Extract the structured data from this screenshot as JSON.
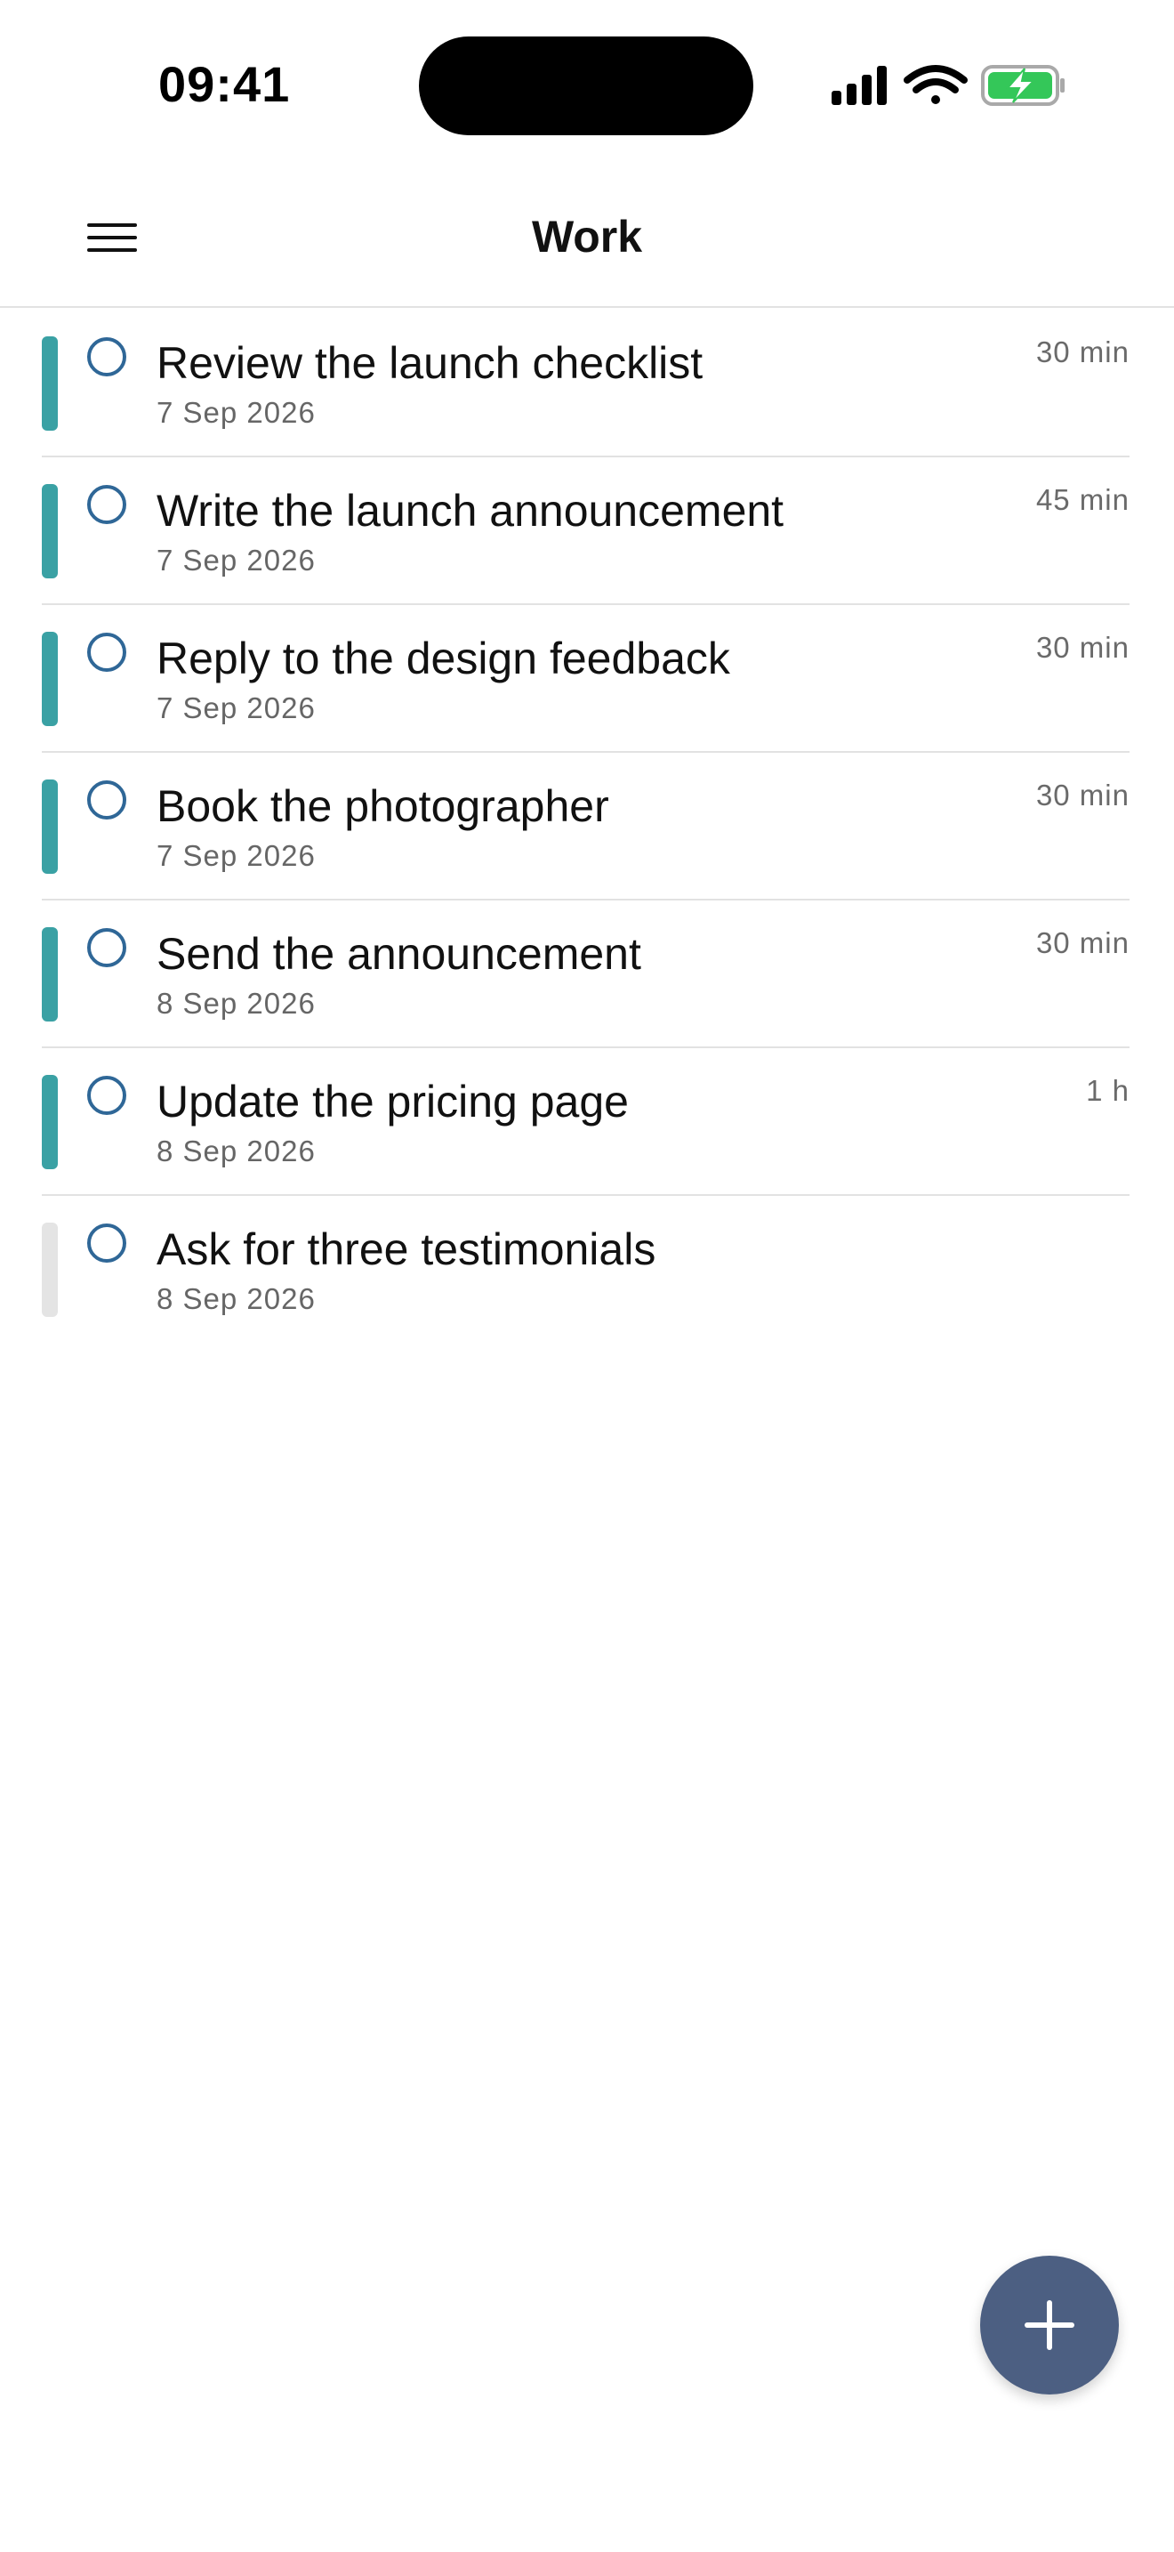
{
  "status_bar": {
    "time": "09:41"
  },
  "header": {
    "title": "Work",
    "menu_icon": "hamburger-menu-icon"
  },
  "colors": {
    "accent_teal": "#3aa1a4",
    "inactive_bar": "#e4e4e4",
    "checkbox": "#2f6797",
    "fab": "#4c5f82",
    "battery_green": "#34c759"
  },
  "tasks": [
    {
      "title": "Review the launch checklist",
      "date": "7 Sep 2026",
      "duration": "30 min",
      "priority": "teal"
    },
    {
      "title": "Write the launch announcement",
      "date": "7 Sep 2026",
      "duration": "45 min",
      "priority": "teal"
    },
    {
      "title": "Reply to the design feedback",
      "date": "7 Sep 2026",
      "duration": "30 min",
      "priority": "teal"
    },
    {
      "title": "Book the photographer",
      "date": "7 Sep 2026",
      "duration": "30 min",
      "priority": "teal"
    },
    {
      "title": "Send the announcement",
      "date": "8 Sep 2026",
      "duration": "30 min",
      "priority": "teal"
    },
    {
      "title": "Update the pricing page",
      "date": "8 Sep 2026",
      "duration": "1 h",
      "priority": "teal"
    },
    {
      "title": "Ask for three testimonials",
      "date": "8 Sep 2026",
      "duration": "",
      "priority": "none"
    }
  ],
  "fab": {
    "icon": "plus-icon"
  }
}
